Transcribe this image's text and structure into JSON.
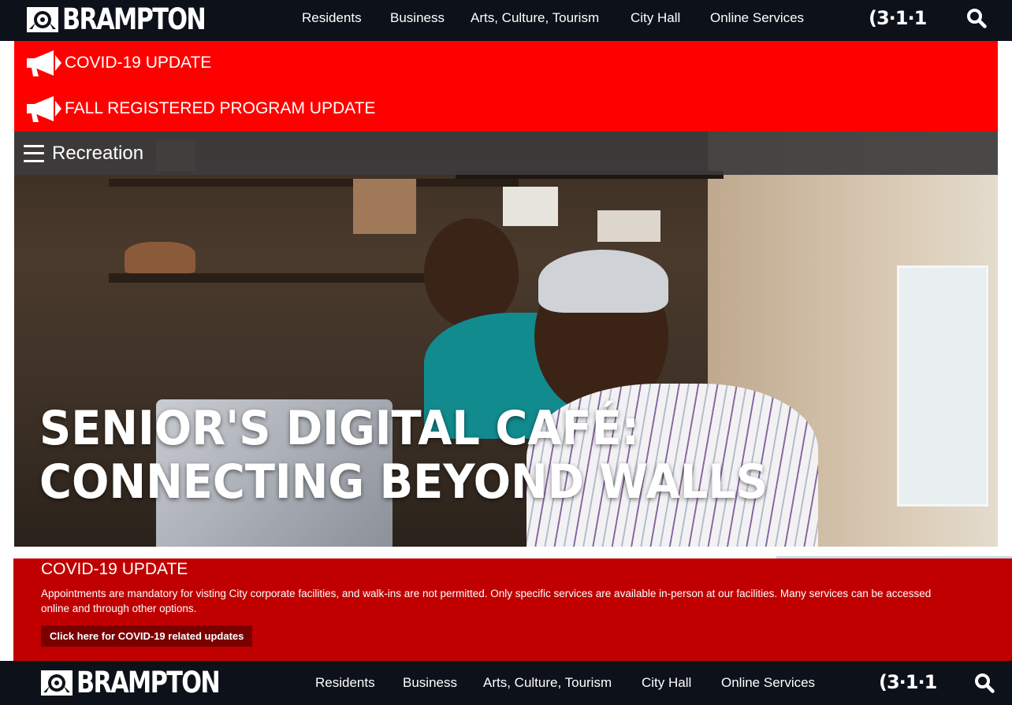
{
  "header": {
    "logo_text": "BRAMPTON",
    "nav": [
      "Residents",
      "Business",
      "Arts, Culture, Tourism",
      "City Hall",
      "Online Services"
    ],
    "service_number": "(3·1·1"
  },
  "alerts": [
    {
      "label": "COVID-19 UPDATE",
      "icon": "megaphone-icon"
    },
    {
      "label": "FALL REGISTERED PROGRAM UPDATE",
      "icon": "megaphone-icon"
    }
  ],
  "section": {
    "label": "Recreation"
  },
  "hero": {
    "title_line1": "SENIOR'S DIGITAL CAFÉ:",
    "title_line2": "CONNECTING BEYOND WALLS"
  },
  "covid": {
    "title": "COVID-19 UPDATE",
    "body": "Appointments are mandatory for visting City corporate facilities, and walk-ins are not permitted. Only specific services are available in-person at our facilities. Many services can be accessed online and through other options.",
    "button": "Click here for COVID-19 related updates"
  },
  "colors": {
    "nav_bg": "#0d1119",
    "alert_bg": "#ff0000",
    "covid_bg": "#c00000",
    "button_bg": "#7a0000"
  }
}
